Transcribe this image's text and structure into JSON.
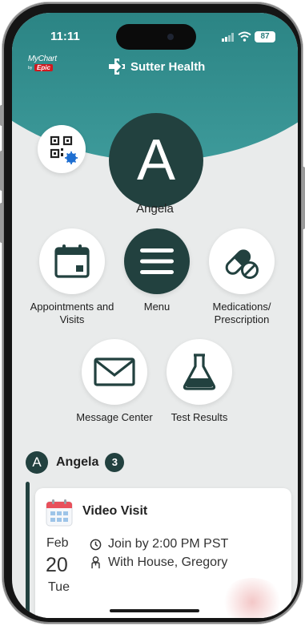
{
  "status_bar": {
    "time": "11:11",
    "battery": "87"
  },
  "branding": {
    "mychart": "MyChart",
    "by": "by",
    "epic": "Epic",
    "brand_name": "Sutter Health"
  },
  "profile": {
    "initial": "A",
    "name": "Angela"
  },
  "menu_tiles": [
    {
      "label": "Appointments and Visits",
      "icon": "calendar-icon"
    },
    {
      "label": "Menu",
      "icon": "hamburger-menu-icon"
    },
    {
      "label": "Medications/ Prescription",
      "icon": "pill-icon"
    },
    {
      "label": "Message Center",
      "icon": "envelope-icon"
    },
    {
      "label": "Test Results",
      "icon": "flask-icon"
    }
  ],
  "feed": {
    "initial": "A",
    "name": "Angela",
    "count": "3",
    "card": {
      "title": "Video Visit",
      "month": "Feb",
      "day": "20",
      "weekday": "Tue",
      "join_text": "Join by 2:00 PM PST",
      "provider_text": "With House, Gregory"
    }
  },
  "colors": {
    "teal": "#2c8585",
    "dark_green": "#22413f",
    "epic_red": "#d0191f"
  }
}
